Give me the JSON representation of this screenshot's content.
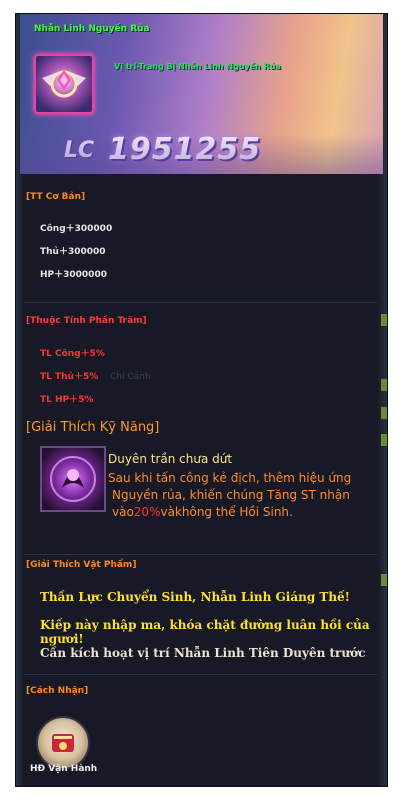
{
  "header": {
    "title": "Nhẫn Linh Nguyền Rủa",
    "subtitle": "Vị trí-Trang Bị Nhẫn Linh   Nguyền Rủa",
    "power_label": "LC",
    "power_value": "1951255"
  },
  "basic_stats": {
    "title": "[TT Cơ Bản]",
    "items": [
      "Công＋300000",
      "Thủ＋300000",
      "HP＋3000000"
    ]
  },
  "percent_stats": {
    "title": "[Thuộc Tính Phần Trăm]",
    "items": [
      "TL Công＋5%",
      "TL Thủ＋5%",
      "TL HP＋5%"
    ]
  },
  "skill": {
    "title": "[Giải Thích Kỹ Năng]",
    "name": "Duyên trần chưa dứt",
    "desc_line1": "Sau khi tấn công kẻ địch, thêm hiệu ứng",
    "desc_line2": "Nguyền rủa, khiến chúng Tăng ST nhận",
    "desc_prefix": "vào",
    "desc_pct": "20%",
    "desc_suffix": "vàkhông thể Hồi Sinh."
  },
  "item_desc": {
    "title": "[Giải Thích Vật Phẩm]",
    "lines": [
      "Thần Lực Chuyển Sinh, Nhẫn Linh Giáng Thế!",
      "Kiếp này nhập ma, khóa chặt đường luân hồi của ngươi!",
      "Cần kích hoạt vị trí Nhẫn Linh Tiên Duyên trước"
    ]
  },
  "obtain": {
    "title": "[Cách Nhận]",
    "source_label": "HĐ Vận Hành"
  },
  "colors": {
    "accent_orange": "#ff8a1c",
    "stat_red": "#ff3030",
    "item_yellow": "#ffe030",
    "title_green": "#3dff3a"
  }
}
